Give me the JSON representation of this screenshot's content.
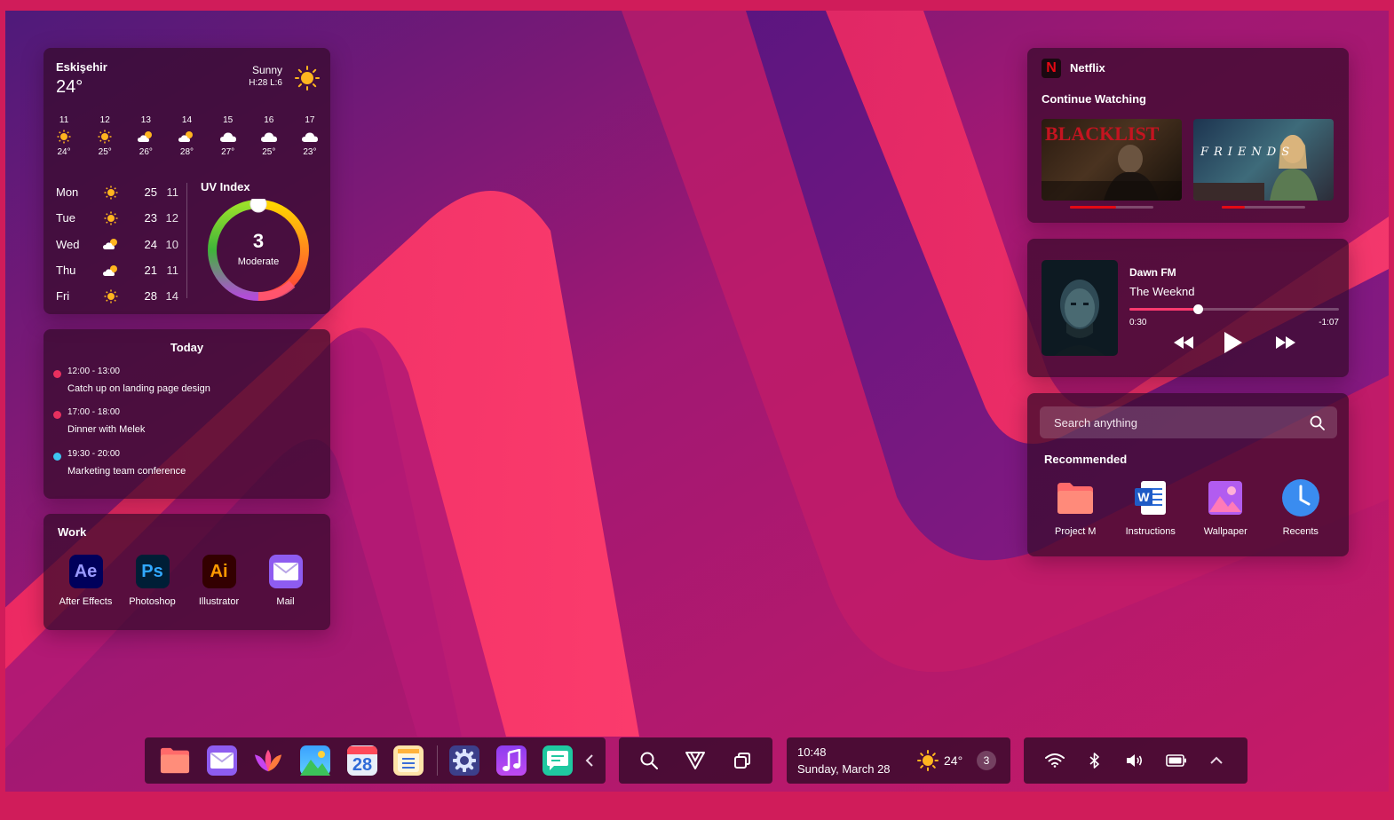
{
  "weather": {
    "city": "Eskişehir",
    "temp": "24°",
    "condition": "Sunny",
    "high_low": "H:28 L:6",
    "hourly": [
      {
        "hour": "11",
        "icon": "sun-icon",
        "temp": "24°"
      },
      {
        "hour": "12",
        "icon": "sun-icon",
        "temp": "25°"
      },
      {
        "hour": "13",
        "icon": "partly-cloudy-icon",
        "temp": "26°"
      },
      {
        "hour": "14",
        "icon": "partly-cloudy-icon",
        "temp": "28°"
      },
      {
        "hour": "15",
        "icon": "cloud-icon",
        "temp": "27°"
      },
      {
        "hour": "16",
        "icon": "cloud-icon",
        "temp": "25°"
      },
      {
        "hour": "17",
        "icon": "cloud-icon",
        "temp": "23°"
      }
    ],
    "daily": [
      {
        "day": "Mon",
        "icon": "sun-icon",
        "high": "25",
        "low": "11"
      },
      {
        "day": "Tue",
        "icon": "sun-icon",
        "high": "23",
        "low": "12"
      },
      {
        "day": "Wed",
        "icon": "partly-cloudy-icon",
        "high": "24",
        "low": "10"
      },
      {
        "day": "Thu",
        "icon": "partly-cloudy-icon",
        "high": "21",
        "low": "11"
      },
      {
        "day": "Fri",
        "icon": "sun-icon",
        "high": "28",
        "low": "14"
      }
    ],
    "uv": {
      "title": "UV Index",
      "value": "3",
      "label": "Moderate",
      "level": 0.0
    }
  },
  "agenda": {
    "title": "Today",
    "events": [
      {
        "time": "12:00 - 13:00",
        "title": "Catch up on landing page design",
        "color": "#e8305f"
      },
      {
        "time": "17:00 - 18:00",
        "title": "Dinner with Melek",
        "color": "#e8305f"
      },
      {
        "time": "19:30 - 20:00",
        "title": "Marketing team conference",
        "color": "#3ec5f0"
      }
    ]
  },
  "work": {
    "title": "Work",
    "apps": [
      {
        "name": "After Effects",
        "abbr": "Ae",
        "bg": "#00005b",
        "fg": "#9999ff"
      },
      {
        "name": "Photoshop",
        "abbr": "Ps",
        "bg": "#001e36",
        "fg": "#31a8ff"
      },
      {
        "name": "Illustrator",
        "abbr": "Ai",
        "bg": "#330000",
        "fg": "#ff9a00"
      },
      {
        "name": "Mail",
        "abbr": "",
        "bg": "#8e5cf0",
        "fg": "#ffffff"
      }
    ]
  },
  "netflix": {
    "app": "Netflix",
    "logo": "N",
    "section": "Continue Watching",
    "shows": [
      {
        "caption": "BLACKLIST",
        "progress": 0.55
      },
      {
        "caption": "FRIENDS",
        "progress": 0.28
      }
    ]
  },
  "music": {
    "album": "Dawn FM",
    "artist": "The Weeknd",
    "elapsed": "0:30",
    "remaining": "-1:07",
    "progress": 0.33
  },
  "search": {
    "placeholder": "Search anything",
    "recommended_title": "Recommended",
    "items": [
      {
        "label": "Project M",
        "icon": "folder-icon"
      },
      {
        "label": "Instructions",
        "icon": "word-document-icon"
      },
      {
        "label": "Wallpaper",
        "icon": "image-icon"
      },
      {
        "label": "Recents",
        "icon": "clock-icon"
      }
    ]
  },
  "dock": {
    "apps": [
      {
        "name": "files",
        "icon": "folder-icon"
      },
      {
        "name": "mail",
        "icon": "mail-icon"
      },
      {
        "name": "lotus",
        "icon": "lotus-icon"
      },
      {
        "name": "photos",
        "icon": "photos-icon"
      },
      {
        "name": "calendar",
        "icon": "calendar-icon",
        "text": "28"
      },
      {
        "name": "notes",
        "icon": "notes-icon"
      },
      {
        "name": "settings",
        "icon": "gear-icon"
      },
      {
        "name": "music",
        "icon": "music-icon"
      },
      {
        "name": "messages",
        "icon": "chat-icon"
      }
    ]
  },
  "clock": {
    "time": "10:48",
    "date": "Sunday, March 28",
    "temp": "24°",
    "notifications": "3"
  }
}
